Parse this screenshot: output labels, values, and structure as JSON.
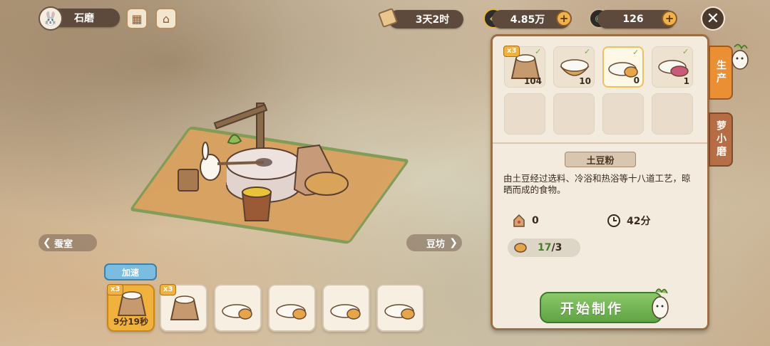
{
  "topbar": {
    "location": "石磨",
    "time": "3天2时",
    "money": "4.85万",
    "gems": "126",
    "plus": "+",
    "close": "✕"
  },
  "nav": {
    "left": "蚕室",
    "right": "豆坊",
    "left_arrow": "❮",
    "right_arrow": "❯"
  },
  "queue": {
    "speed_label": "加速",
    "items": [
      {
        "badge": "x3",
        "time": "9分19秒",
        "active": true
      },
      {
        "badge": "x3",
        "time": "",
        "active": false
      },
      {
        "badge": "",
        "time": "",
        "active": false
      },
      {
        "badge": "",
        "time": "",
        "active": false
      },
      {
        "badge": "",
        "time": "",
        "active": false
      },
      {
        "badge": "",
        "time": "",
        "active": false
      }
    ]
  },
  "panel": {
    "tabs": {
      "produce": "生产",
      "mill": "萝小磨"
    },
    "recipes": [
      {
        "badge": "x3",
        "count": "104",
        "selected": false
      },
      {
        "badge": "",
        "count": "10",
        "selected": false
      },
      {
        "badge": "",
        "count": "0",
        "selected": true
      },
      {
        "badge": "",
        "count": "1",
        "selected": false
      }
    ],
    "item_title": "土豆粉",
    "description": "由土豆经过选料、冷浴和热浴等十八道工艺，晾晒而成的食物。",
    "stock": "0",
    "duration": "42分",
    "ingredient_have": "17",
    "ingredient_need": "/3",
    "start_label": "开始制作"
  }
}
